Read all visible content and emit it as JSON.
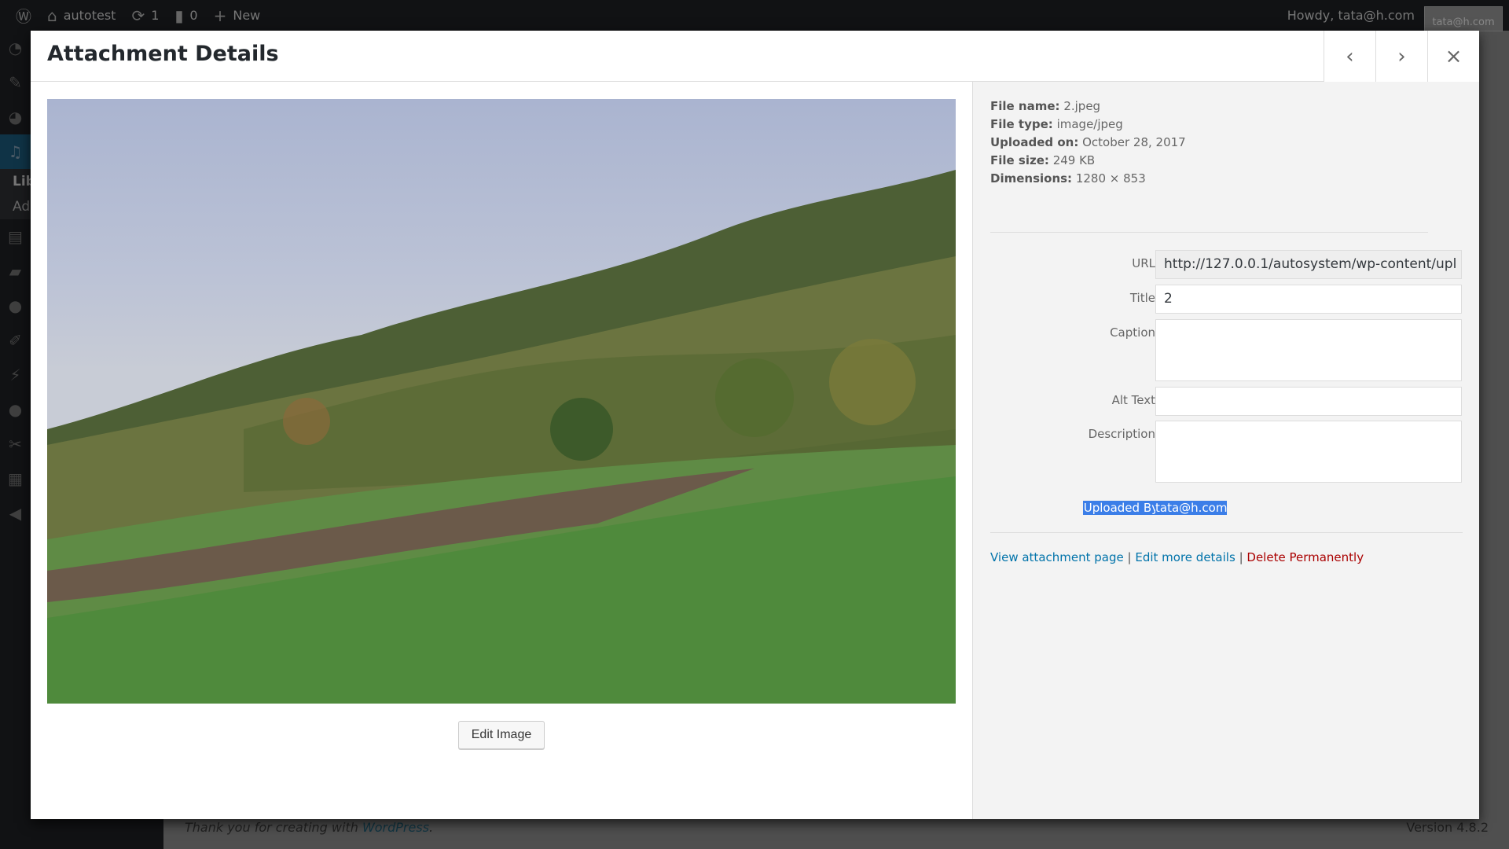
{
  "adminbar": {
    "site": "autotest",
    "updates": "1",
    "comments": "0",
    "new": "New",
    "howdy": "Howdy, tata@h.com",
    "avatar_text": "tata@h.com"
  },
  "sidebar": {
    "sub_items": [
      "Lib",
      "Ad"
    ]
  },
  "footer": {
    "text": "Thank you for creating with ",
    "link": "WordPress",
    "end": ".",
    "version": "Version 4.8.2"
  },
  "modal": {
    "title": "Attachment Details",
    "prev": "‹",
    "next": "›",
    "close": "×",
    "edit_image": "Edit Image"
  },
  "meta": [
    {
      "label": "File name:",
      "value": "2.jpeg"
    },
    {
      "label": "File type:",
      "value": "image/jpeg"
    },
    {
      "label": "Uploaded on:",
      "value": "October 28, 2017"
    },
    {
      "label": "File size:",
      "value": "249 KB"
    },
    {
      "label": "Dimensions:",
      "value": "1280 × 853"
    }
  ],
  "fields": {
    "url": {
      "label": "URL",
      "value": "http://127.0.0.1/autosystem/wp-content/upl"
    },
    "title": {
      "label": "Title",
      "value": "2"
    },
    "caption": {
      "label": "Caption",
      "value": ""
    },
    "alt": {
      "label": "Alt Text",
      "value": ""
    },
    "description": {
      "label": "Description",
      "value": ""
    },
    "uploaded_by": {
      "label": "Uploaded By",
      "value": "tata@h.com"
    }
  },
  "links": {
    "view": "View attachment page",
    "edit": "Edit more details",
    "delete": "Delete Permanently",
    "sep": "|"
  },
  "colors": {
    "link": "#0073aa",
    "delete": "#a00000",
    "selection": "#3b7ee8"
  }
}
